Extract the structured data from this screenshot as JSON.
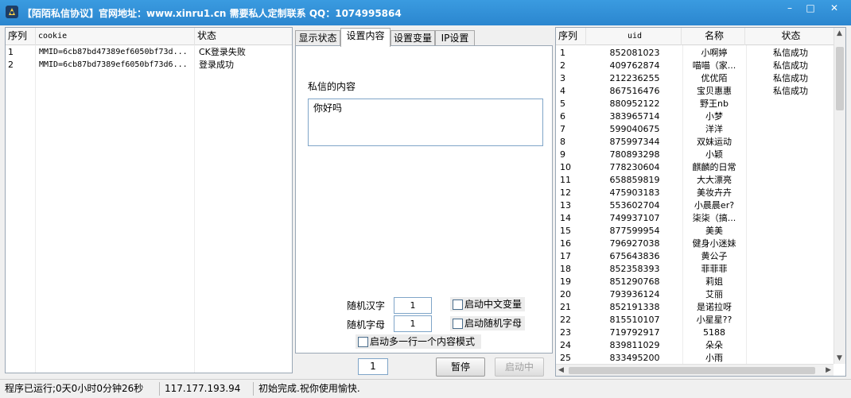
{
  "window": {
    "title": "【陌陌私信协议】官网地址：www.xinru1.cn    需要私人定制联系 QQ：1074995864",
    "minimize": "–",
    "maximize": "□",
    "close": "✕"
  },
  "left_table": {
    "columns": [
      "序列",
      "cookie",
      "状态"
    ],
    "rows": [
      {
        "seq": "1",
        "cookie": "MMID=6cb87bd47389ef6050bf73d...",
        "status": "CK登录失败"
      },
      {
        "seq": "2",
        "cookie": "MMID=6cb87bd7389ef6050bf73d6...",
        "status": "登录成功"
      }
    ]
  },
  "tabs": [
    "显示状态",
    "设置内容",
    "设置变量",
    "IP设置"
  ],
  "settings": {
    "content_label": "私信的内容",
    "content_value": "你好吗",
    "random_hanzi_label": "随机汉字",
    "random_hanzi_value": "1",
    "random_letter_label": "随机字母",
    "random_letter_value": "1",
    "enable_cn_var": "启动中文变量",
    "enable_random_letter": "启动随机字母",
    "enable_multiline": "启动多一行一个内容模式"
  },
  "controls": {
    "count": "1",
    "pause": "暂停",
    "start": "启动中"
  },
  "right_table": {
    "columns": [
      "序列",
      "uid",
      "名称",
      "状态"
    ],
    "rows": [
      {
        "seq": "1",
        "uid": "852081023",
        "name": "小啊婷",
        "status": "私信成功"
      },
      {
        "seq": "2",
        "uid": "409762874",
        "name": "喵喵（家...",
        "status": "私信成功"
      },
      {
        "seq": "3",
        "uid": "212236255",
        "name": "优优陌",
        "status": "私信成功"
      },
      {
        "seq": "4",
        "uid": "867516476",
        "name": "宝贝惠惠",
        "status": "私信成功"
      },
      {
        "seq": "5",
        "uid": "880952122",
        "name": "野王nb",
        "status": ""
      },
      {
        "seq": "6",
        "uid": "383965714",
        "name": "小梦",
        "status": ""
      },
      {
        "seq": "7",
        "uid": "599040675",
        "name": "洋洋",
        "status": ""
      },
      {
        "seq": "8",
        "uid": "875997344",
        "name": "双妹运动",
        "status": ""
      },
      {
        "seq": "9",
        "uid": "780893298",
        "name": "小颖",
        "status": ""
      },
      {
        "seq": "10",
        "uid": "778230604",
        "name": "麒麟的日常",
        "status": ""
      },
      {
        "seq": "11",
        "uid": "658859819",
        "name": "大大漂亮",
        "status": ""
      },
      {
        "seq": "12",
        "uid": "475903183",
        "name": "美妆卉卉",
        "status": ""
      },
      {
        "seq": "13",
        "uid": "553602704",
        "name": "小晨晨er?",
        "status": ""
      },
      {
        "seq": "14",
        "uid": "749937107",
        "name": "柒柒（搞...",
        "status": ""
      },
      {
        "seq": "15",
        "uid": "877599954",
        "name": "美美",
        "status": ""
      },
      {
        "seq": "16",
        "uid": "796927038",
        "name": "健身小迷妹",
        "status": ""
      },
      {
        "seq": "17",
        "uid": "675643836",
        "name": "黄公子",
        "status": ""
      },
      {
        "seq": "18",
        "uid": "852358393",
        "name": "菲菲菲",
        "status": ""
      },
      {
        "seq": "19",
        "uid": "851290768",
        "name": "莉姐",
        "status": ""
      },
      {
        "seq": "20",
        "uid": "793936124",
        "name": "艾丽",
        "status": ""
      },
      {
        "seq": "21",
        "uid": "852191338",
        "name": "是诺拉呀",
        "status": ""
      },
      {
        "seq": "22",
        "uid": "815510107",
        "name": "小星星??",
        "status": ""
      },
      {
        "seq": "23",
        "uid": "719792917",
        "name": "5188",
        "status": ""
      },
      {
        "seq": "24",
        "uid": "839811029",
        "name": "朵朵",
        "status": ""
      },
      {
        "seq": "25",
        "uid": "833495200",
        "name": "小雨",
        "status": ""
      }
    ]
  },
  "status_bar": {
    "runtime": "程序已运行;0天0小时0分钟26秒",
    "ip": "117.177.193.94",
    "message": "初始完成.祝你使用愉快."
  },
  "colors": {
    "title_bar": "#2b86cf",
    "panel_border": "#9aa7b5",
    "input_border": "#7fa5c8"
  }
}
